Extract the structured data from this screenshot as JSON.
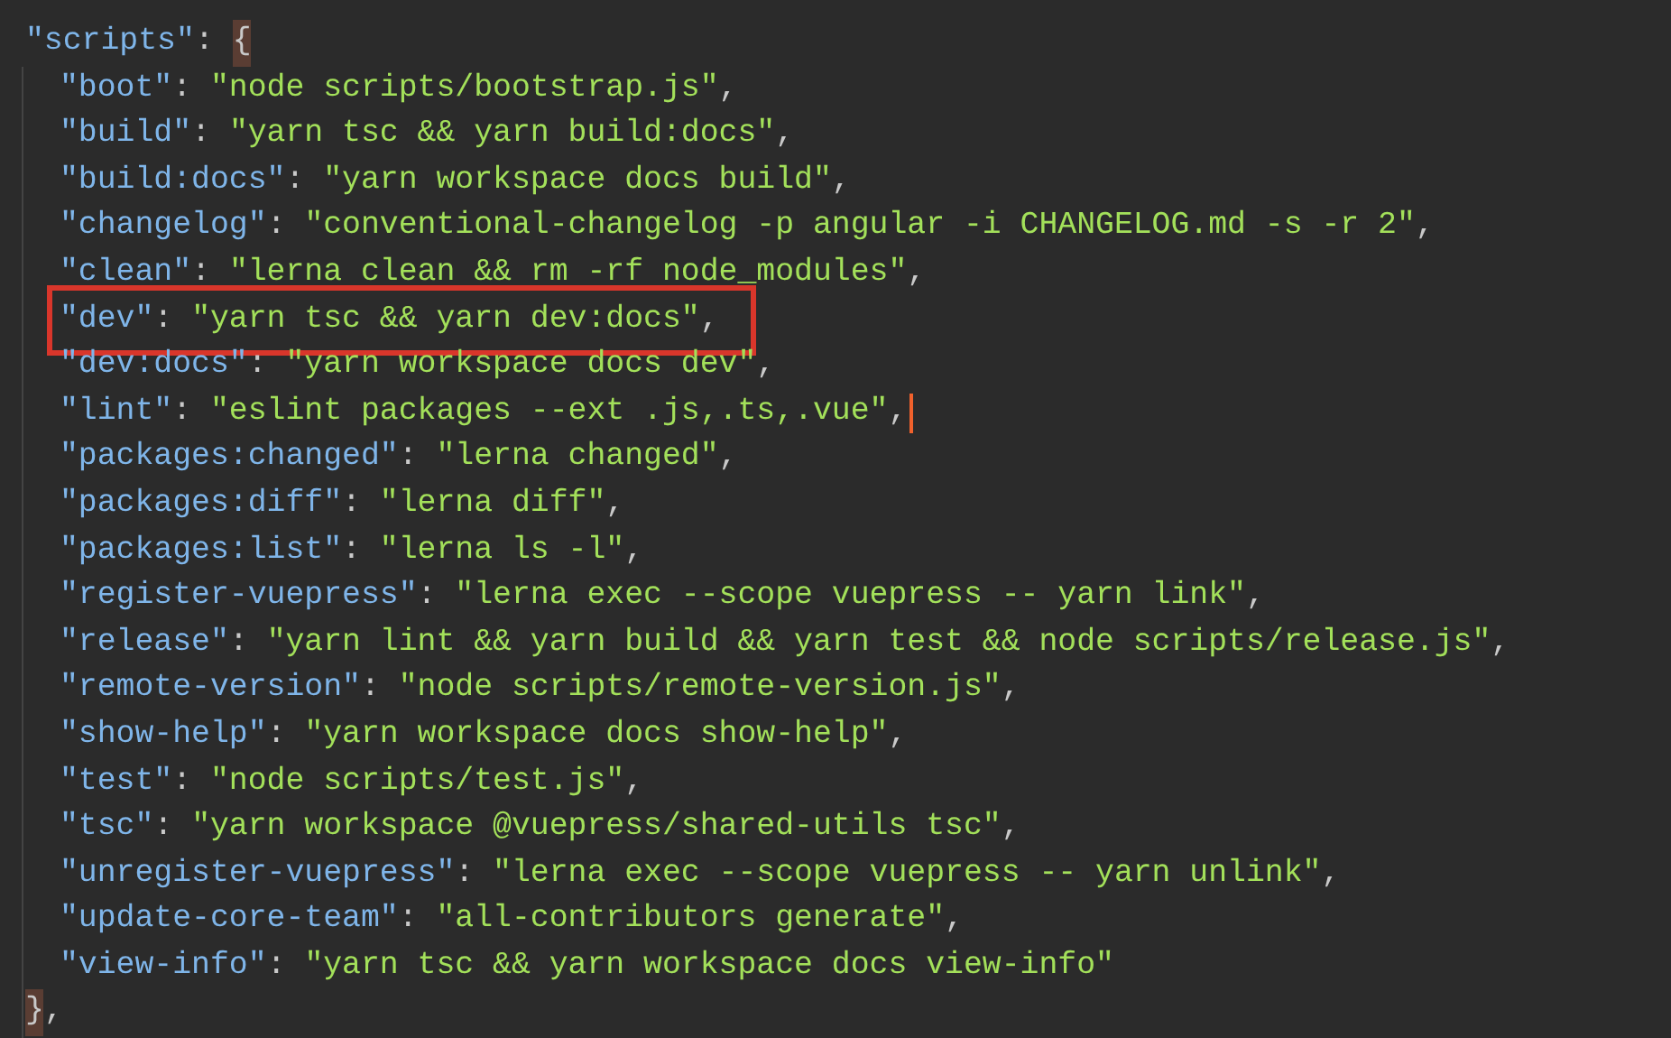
{
  "header": {
    "key": "\"scripts\"",
    "separator": ": ",
    "open_brace": "{",
    "brace_matched": true
  },
  "entries": [
    {
      "key": "\"boot\"",
      "separator": ": ",
      "value": "\"node scripts/bootstrap.js\"",
      "comma": ",",
      "highlighted": false,
      "cursor": false
    },
    {
      "key": "\"build\"",
      "separator": ": ",
      "value": "\"yarn tsc && yarn build:docs\"",
      "comma": ",",
      "highlighted": false,
      "cursor": false
    },
    {
      "key": "\"build:docs\"",
      "separator": ": ",
      "value": "\"yarn workspace docs build\"",
      "comma": ",",
      "highlighted": false,
      "cursor": false
    },
    {
      "key": "\"changelog\"",
      "separator": ": ",
      "value": "\"conventional-changelog -p angular -i CHANGELOG.md -s -r 2\"",
      "comma": ",",
      "highlighted": false,
      "cursor": false
    },
    {
      "key": "\"clean\"",
      "separator": ": ",
      "value": "\"lerna clean && rm -rf node_modules\"",
      "comma": ",",
      "highlighted": false,
      "cursor": false
    },
    {
      "key": "\"dev\"",
      "separator": ": ",
      "value": "\"yarn tsc && yarn dev:docs\"",
      "comma": ",",
      "highlighted": true,
      "cursor": false
    },
    {
      "key": "\"dev:docs\"",
      "separator": ": ",
      "value": "\"yarn workspace docs dev\"",
      "comma": ",",
      "highlighted": false,
      "cursor": false
    },
    {
      "key": "\"lint\"",
      "separator": ": ",
      "value": "\"eslint packages --ext .js,.ts,.vue\"",
      "comma": ",",
      "highlighted": false,
      "cursor": true
    },
    {
      "key": "\"packages:changed\"",
      "separator": ": ",
      "value": "\"lerna changed\"",
      "comma": ",",
      "highlighted": false,
      "cursor": false
    },
    {
      "key": "\"packages:diff\"",
      "separator": ": ",
      "value": "\"lerna diff\"",
      "comma": ",",
      "highlighted": false,
      "cursor": false
    },
    {
      "key": "\"packages:list\"",
      "separator": ": ",
      "value": "\"lerna ls -l\"",
      "comma": ",",
      "highlighted": false,
      "cursor": false
    },
    {
      "key": "\"register-vuepress\"",
      "separator": ": ",
      "value": "\"lerna exec --scope vuepress -- yarn link\"",
      "comma": ",",
      "highlighted": false,
      "cursor": false
    },
    {
      "key": "\"release\"",
      "separator": ": ",
      "value": "\"yarn lint && yarn build && yarn test && node scripts/release.js\"",
      "comma": ",",
      "highlighted": false,
      "cursor": false
    },
    {
      "key": "\"remote-version\"",
      "separator": ": ",
      "value": "\"node scripts/remote-version.js\"",
      "comma": ",",
      "highlighted": false,
      "cursor": false
    },
    {
      "key": "\"show-help\"",
      "separator": ": ",
      "value": "\"yarn workspace docs show-help\"",
      "comma": ",",
      "highlighted": false,
      "cursor": false
    },
    {
      "key": "\"test\"",
      "separator": ": ",
      "value": "\"node scripts/test.js\"",
      "comma": ",",
      "highlighted": false,
      "cursor": false
    },
    {
      "key": "\"tsc\"",
      "separator": ": ",
      "value": "\"yarn workspace @vuepress/shared-utils tsc\"",
      "comma": ",",
      "highlighted": false,
      "cursor": false
    },
    {
      "key": "\"unregister-vuepress\"",
      "separator": ": ",
      "value": "\"lerna exec --scope vuepress -- yarn unlink\"",
      "comma": ",",
      "highlighted": false,
      "cursor": false
    },
    {
      "key": "\"update-core-team\"",
      "separator": ": ",
      "value": "\"all-contributors generate\"",
      "comma": ",",
      "highlighted": false,
      "cursor": false
    },
    {
      "key": "\"view-info\"",
      "separator": ": ",
      "value": "\"yarn tsc && yarn workspace docs view-info\"",
      "highlighted": false,
      "cursor": false
    }
  ],
  "footer": {
    "close_brace": "}",
    "comma": ","
  }
}
